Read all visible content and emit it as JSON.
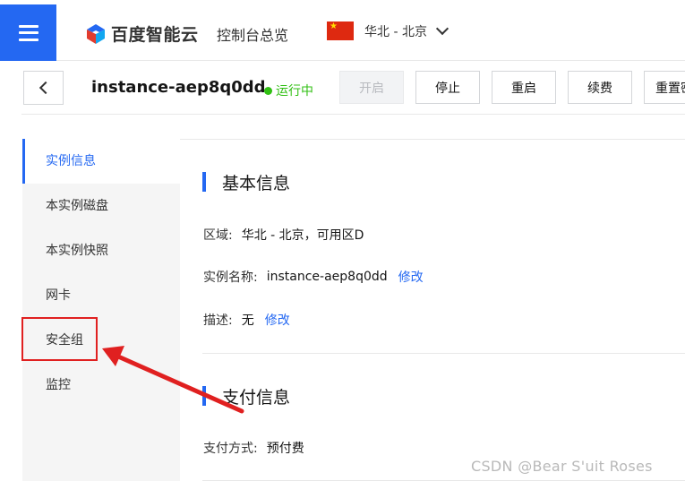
{
  "topbar": {
    "logo_text": "百度智能云",
    "console_title": "控制台总览",
    "region_label": "华北 - 北京"
  },
  "instance": {
    "name": "instance-aep8q0dd",
    "status": "运行中",
    "actions": {
      "start": "开启",
      "stop": "停止",
      "restart": "重启",
      "renew": "续费",
      "reset": "重置密"
    }
  },
  "sidebar": {
    "items": [
      {
        "label": "实例信息"
      },
      {
        "label": "本实例磁盘"
      },
      {
        "label": "本实例快照"
      },
      {
        "label": "网卡"
      },
      {
        "label": "安全组"
      },
      {
        "label": "监控"
      }
    ]
  },
  "basic_info": {
    "title": "基本信息",
    "region_label": "区域:",
    "region_value": "华北 - 北京，可用区D",
    "name_label": "实例名称:",
    "name_value": "instance-aep8q0dd",
    "name_edit": "修改",
    "desc_label": "描述:",
    "desc_value": "无",
    "desc_edit": "修改"
  },
  "payment_info": {
    "title": "支付信息",
    "method_label": "支付方式:",
    "method_value": "预付费"
  },
  "watermark": "CSDN @Bear S'uit  Roses",
  "colors": {
    "accent": "#2468f2",
    "running": "#30bf13",
    "annotation": "#e02020"
  }
}
